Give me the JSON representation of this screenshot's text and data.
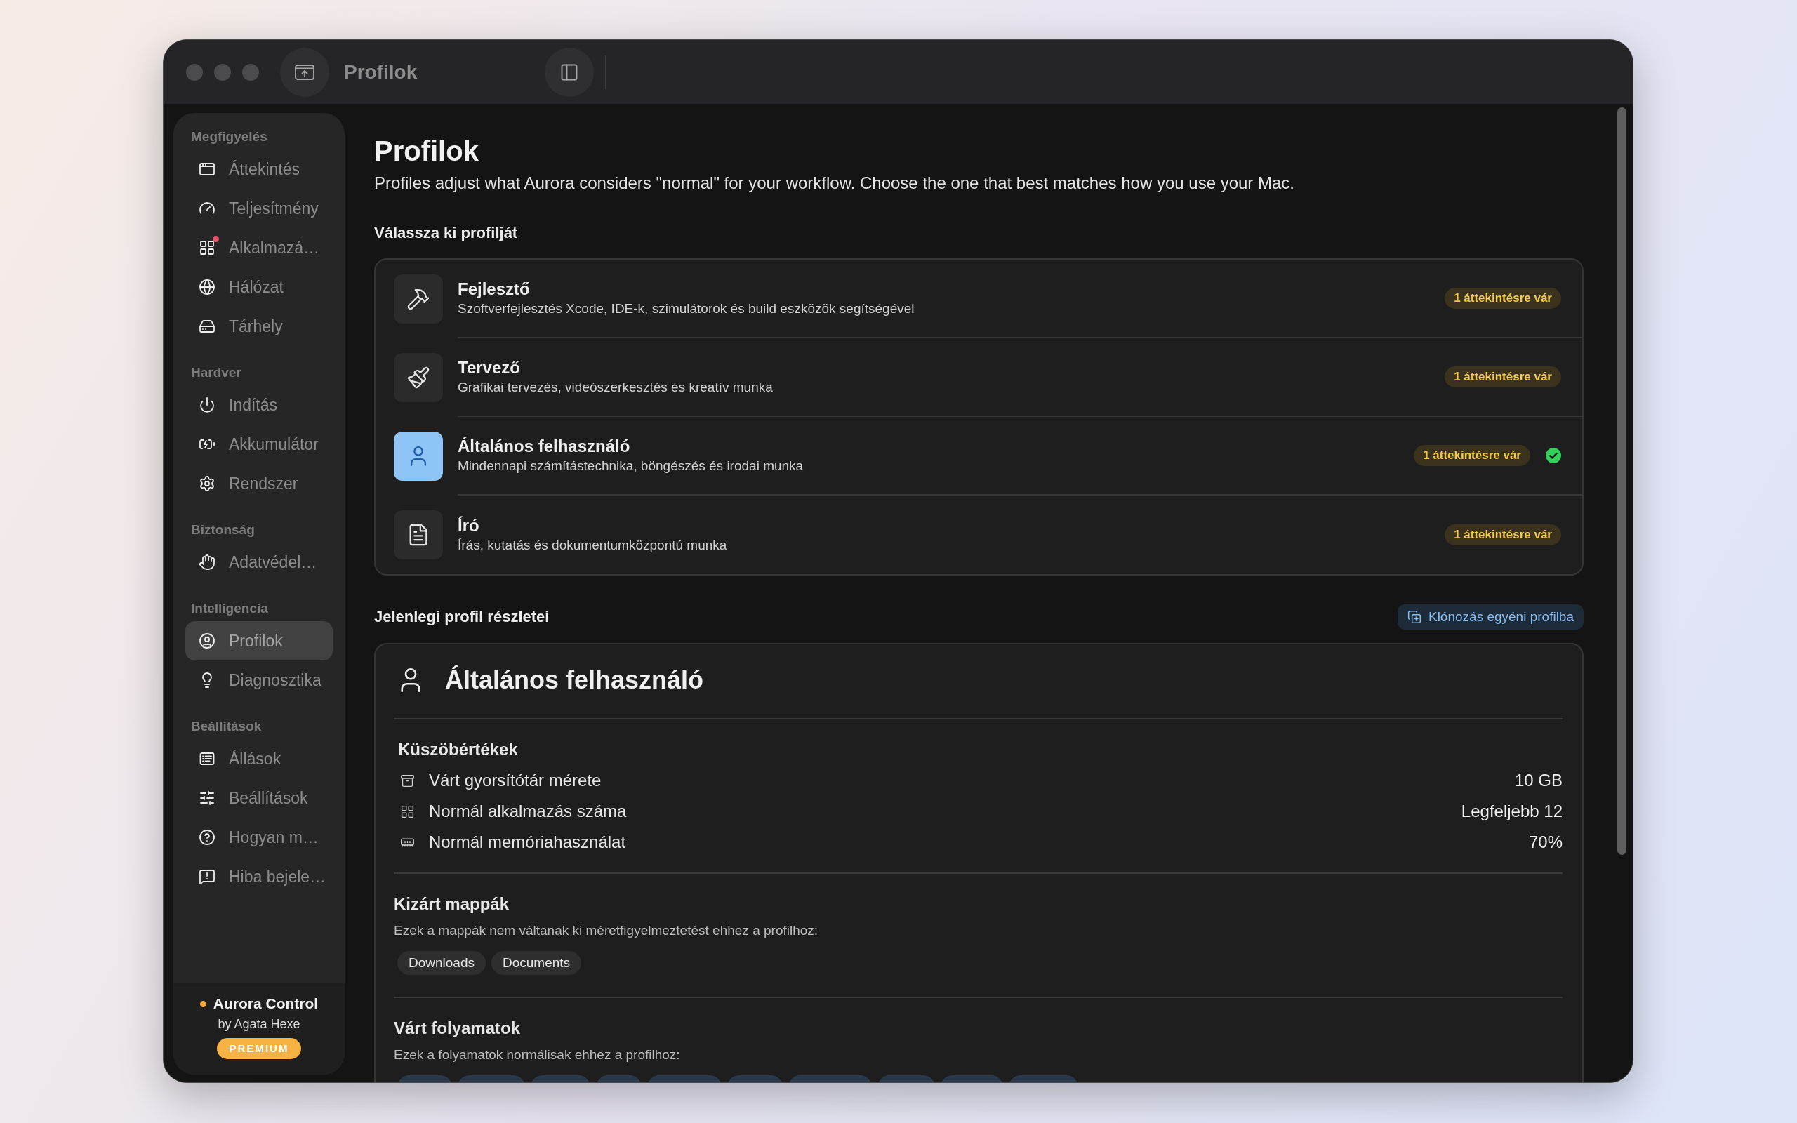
{
  "window": {
    "title": "Profilok"
  },
  "sidebar": {
    "sections": [
      {
        "title": "Megfigyelés",
        "items": [
          {
            "label": "Áttekintés",
            "selected": false,
            "alert": false
          },
          {
            "label": "Teljesítmény",
            "selected": false,
            "alert": false
          },
          {
            "label": "Alkalmazá…",
            "selected": false,
            "alert": true
          },
          {
            "label": "Hálózat",
            "selected": false,
            "alert": false
          },
          {
            "label": "Tárhely",
            "selected": false,
            "alert": false
          }
        ]
      },
      {
        "title": "Hardver",
        "items": [
          {
            "label": "Indítás",
            "selected": false,
            "alert": false
          },
          {
            "label": "Akkumulátor",
            "selected": false,
            "alert": false
          },
          {
            "label": "Rendszer",
            "selected": false,
            "alert": false
          }
        ]
      },
      {
        "title": "Biztonság",
        "items": [
          {
            "label": "Adatvédel…",
            "selected": false,
            "alert": false
          }
        ]
      },
      {
        "title": "Intelligencia",
        "items": [
          {
            "label": "Profilok",
            "selected": true,
            "alert": false
          },
          {
            "label": "Diagnosztika",
            "selected": false,
            "alert": false
          }
        ]
      },
      {
        "title": "Beállítások",
        "items": [
          {
            "label": "Állások",
            "selected": false,
            "alert": false
          },
          {
            "label": "Beállítások",
            "selected": false,
            "alert": false
          },
          {
            "label": "Hogyan m…",
            "selected": false,
            "alert": false
          },
          {
            "label": "Hiba bejele…",
            "selected": false,
            "alert": false
          }
        ]
      }
    ],
    "footer": {
      "app_name": "Aurora Control",
      "author": "by Agata Hexe",
      "badge": "PREMIUM"
    }
  },
  "page": {
    "title": "Profilok",
    "description": "Profiles adjust what Aurora considers \"normal\" for your workflow. Choose the one that best matches how you use your Mac."
  },
  "profile_picker": {
    "heading": "Válassza ki profilját",
    "profiles": [
      {
        "name": "Fejlesztő",
        "description": "Szoftverfejlesztés Xcode, IDE-k, szimulátorok és build eszközök segítségével",
        "badge": "1 áttekintésre vár",
        "selected": false
      },
      {
        "name": "Tervező",
        "description": "Grafikai tervezés, videószerkesztés és kreatív munka",
        "badge": "1 áttekintésre vár",
        "selected": false
      },
      {
        "name": "Általános felhasználó",
        "description": "Mindennapi számítástechnika, böngészés és irodai munka",
        "badge": "1 áttekintésre vár",
        "selected": true
      },
      {
        "name": "Író",
        "description": "Írás, kutatás és dokumentumközpontú munka",
        "badge": "1 áttekintésre vár",
        "selected": false
      }
    ]
  },
  "current_profile": {
    "heading": "Jelenlegi profil részletei",
    "clone_button": "Klónozás egyéni profilba",
    "name": "Általános felhasználó",
    "thresholds": {
      "heading": "Küszöbértékek",
      "rows": [
        {
          "label": "Várt gyorsítótár mérete",
          "value": "10 GB"
        },
        {
          "label": "Normál alkalmazás száma",
          "value": "Legfeljebb 12"
        },
        {
          "label": "Normál memóriahasználat",
          "value": "70%"
        }
      ]
    },
    "excluded_folders": {
      "heading": "Kizárt mappák",
      "description": "Ezek a mappák nem váltanak ki méretfigyelmeztetést ehhez a profilhoz:",
      "folders": [
        "Downloads",
        "Documents"
      ]
    },
    "expected_processes": {
      "heading": "Várt folyamatok",
      "description": "Ezek a folyamatok normálisak ehhez a profilhoz:"
    }
  }
}
